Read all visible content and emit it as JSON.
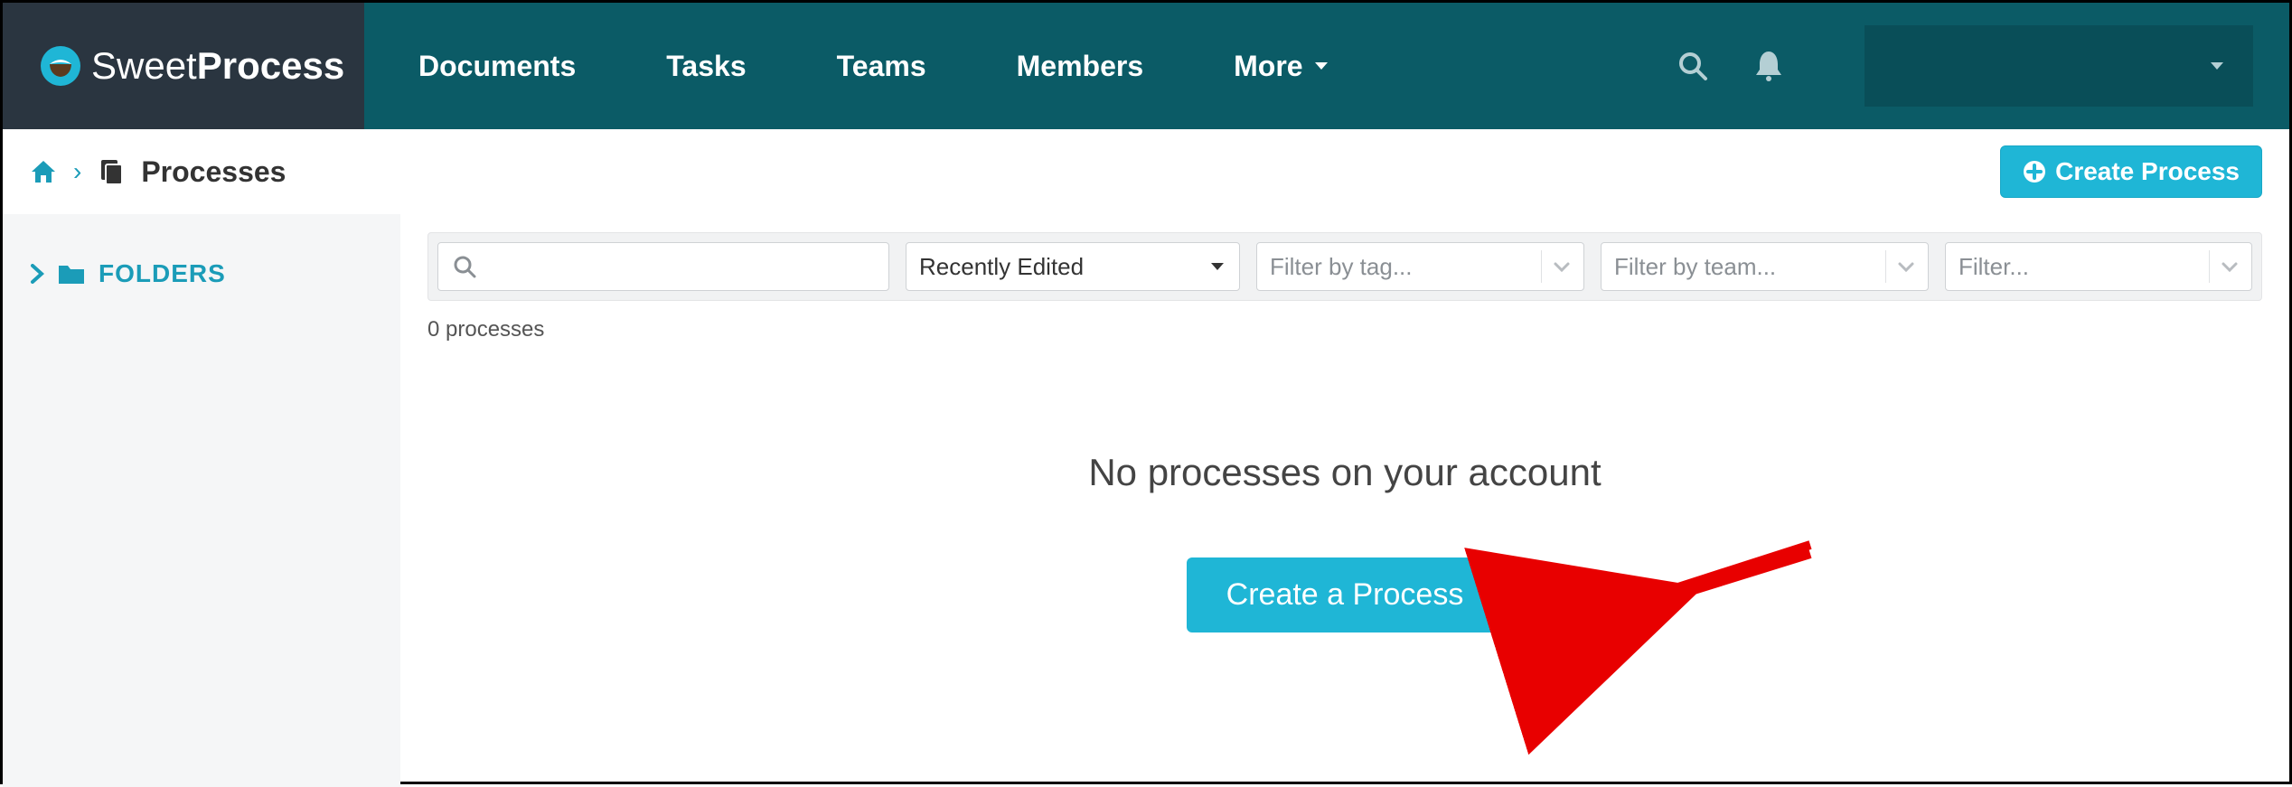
{
  "logo": {
    "sweet": "Sweet",
    "process": "Process"
  },
  "nav": {
    "documents": "Documents",
    "tasks": "Tasks",
    "teams": "Teams",
    "members": "Members",
    "more": "More"
  },
  "breadcrumb": {
    "processes": "Processes"
  },
  "buttons": {
    "create_process_header": "Create Process",
    "create_a_process": "Create a Process"
  },
  "sidebar": {
    "folders": "FOLDERS"
  },
  "filters": {
    "sort_selected": "Recently Edited",
    "tag_placeholder": "Filter by tag...",
    "team_placeholder": "Filter by team...",
    "generic_placeholder": "Filter..."
  },
  "counts": {
    "processes": "0 processes"
  },
  "empty": {
    "heading": "No processes on your account"
  }
}
